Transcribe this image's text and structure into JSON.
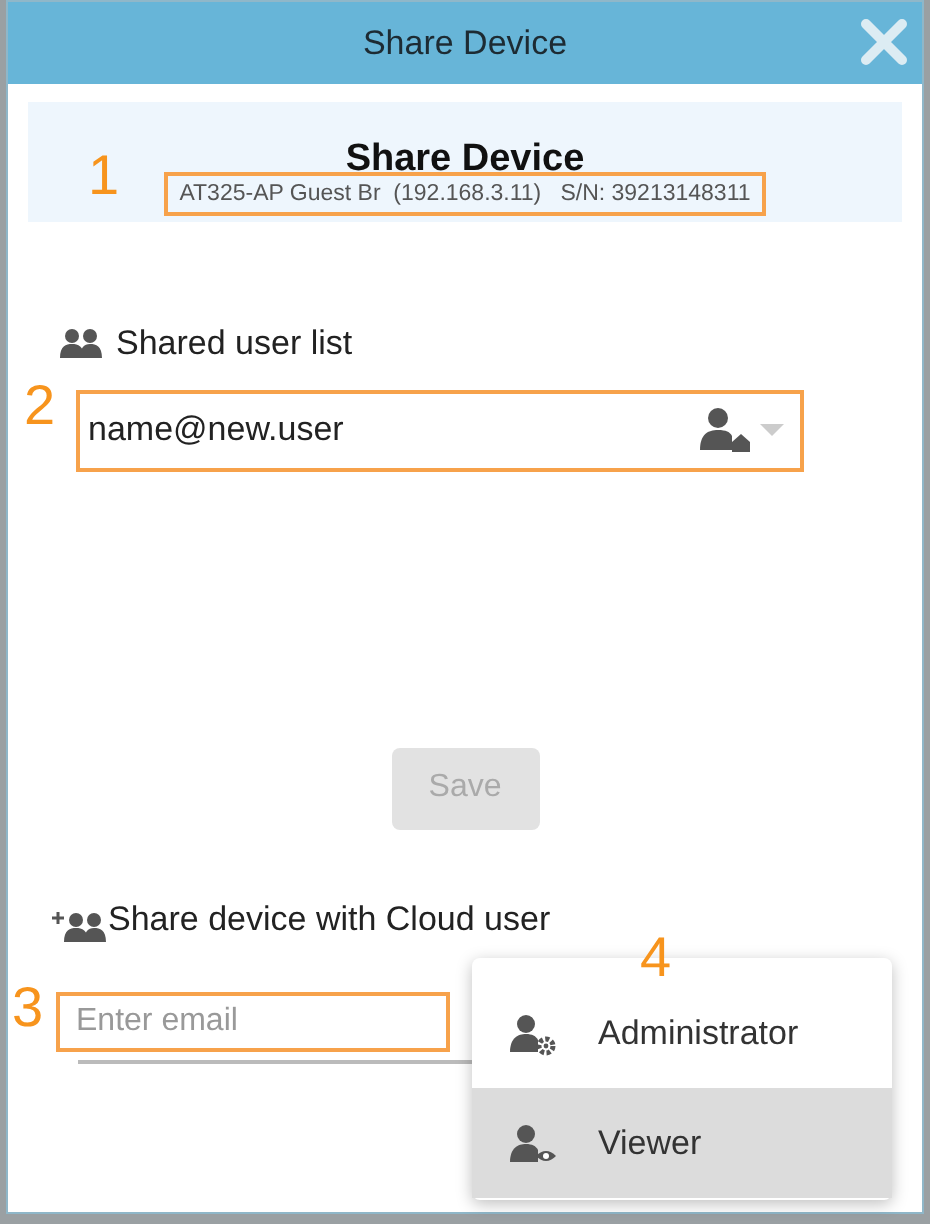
{
  "window": {
    "title": "Share Device"
  },
  "banner": {
    "title": "Share Device",
    "device": "AT325-AP Guest Br  (192.168.3.11)   S/N: 39213148311",
    "callout": "1"
  },
  "shared_users": {
    "label": "Shared user list",
    "value": "name@new.user",
    "callout": "2"
  },
  "save_button": {
    "label": "Save",
    "disabled": true
  },
  "share": {
    "label": "Share device with Cloud user",
    "email_placeholder": "Enter email",
    "callout": "3"
  },
  "role_menu": {
    "callout": "4",
    "items": [
      {
        "kind": "admin",
        "label": "Administrator",
        "selected": false
      },
      {
        "kind": "viewer",
        "label": "Viewer",
        "selected": true
      }
    ]
  }
}
